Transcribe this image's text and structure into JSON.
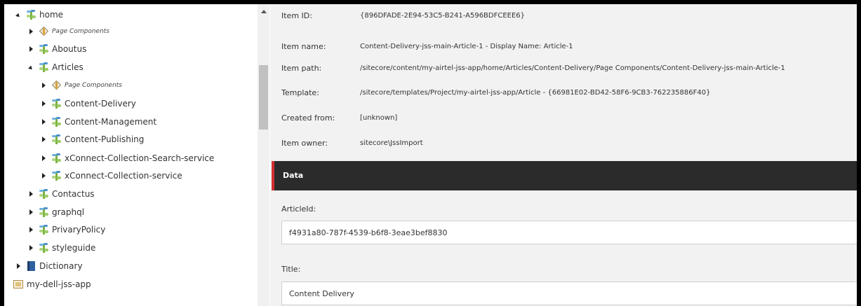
{
  "tree": {
    "items": [
      {
        "label": "home",
        "toggle": "down",
        "icon": "plant-icon",
        "small": false
      },
      {
        "label": "Page Components",
        "toggle": "right",
        "icon": "cube-icon",
        "small": true
      },
      {
        "label": "Aboutus",
        "toggle": "right",
        "icon": "plant-icon",
        "small": false
      },
      {
        "label": "Articles",
        "toggle": "down",
        "icon": "plant-icon",
        "small": false
      },
      {
        "label": "Page Components",
        "toggle": "right",
        "icon": "cube-icon",
        "small": true
      },
      {
        "label": "Content-Delivery",
        "toggle": "right",
        "icon": "plant-icon",
        "small": false
      },
      {
        "label": "Content-Management",
        "toggle": "right",
        "icon": "plant-icon",
        "small": false
      },
      {
        "label": "Content-Publishing",
        "toggle": "right",
        "icon": "plant-icon",
        "small": false
      },
      {
        "label": "xConnect-Collection-Search-service",
        "toggle": "right",
        "icon": "plant-icon",
        "small": false
      },
      {
        "label": "xConnect-Collection-service",
        "toggle": "right",
        "icon": "plant-icon",
        "small": false
      },
      {
        "label": "Contactus",
        "toggle": "right",
        "icon": "plant-icon",
        "small": false
      },
      {
        "label": "graphql",
        "toggle": "right",
        "icon": "plant-icon",
        "small": false
      },
      {
        "label": "PrivaryPolicy",
        "toggle": "right",
        "icon": "plant-icon",
        "small": false
      },
      {
        "label": "styleguide",
        "toggle": "right",
        "icon": "plant-icon",
        "small": false
      },
      {
        "label": "Dictionary",
        "toggle": "right",
        "icon": "book-icon",
        "small": false
      },
      {
        "label": "my-dell-jss-app",
        "toggle": "none",
        "icon": "site-icon",
        "small": false
      }
    ]
  },
  "info": {
    "item_id_key": "Item ID:",
    "item_id_val": "{896DFADE-2E94-53C5-B241-A596BDFCEEE6}",
    "item_name_key": "Item name:",
    "item_name_val": "Content-Delivery-jss-main-Article-1 - Display Name: Article-1",
    "item_path_key": "Item path:",
    "item_path_val": "/sitecore/content/my-airtel-jss-app/home/Articles/Content-Delivery/Page Components/Content-Delivery-jss-main-Article-1",
    "template_key": "Template:",
    "template_val": "/sitecore/templates/Project/my-airtel-jss-app/Article - {66981E02-BD42-58F6-9CB3-762235886F40}",
    "created_from_key": "Created from:",
    "created_from_val": "[unknown]",
    "item_owner_key": "Item owner:",
    "item_owner_val": "sitecore\\JssImport"
  },
  "data_section": {
    "title": "Data",
    "accent": "#d32f2f",
    "article_id_label": "ArticleId:",
    "article_id_value": "f4931a80-787f-4539-b6f8-3eae3bef8830",
    "title_label": "Title:",
    "title_value": "Content Delivery"
  }
}
